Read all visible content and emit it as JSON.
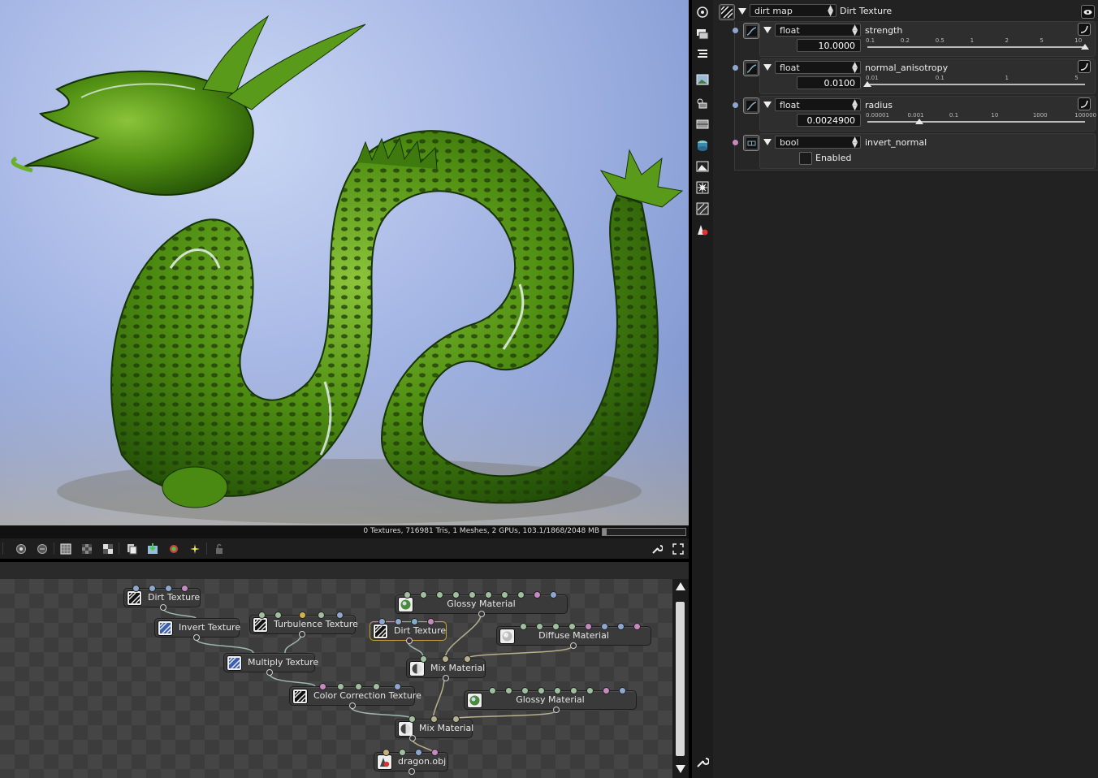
{
  "status": {
    "text": "0 Textures, 716981 Tris, 1 Meshes, 2 GPUs, 103.1/1868/2048 MB",
    "memory_used_fraction": 0.05
  },
  "nodes": [
    {
      "label": "Dirt Texture"
    },
    {
      "label": "Invert Texture"
    },
    {
      "label": "Turbulence Texture"
    },
    {
      "label": "Multiply Texture"
    },
    {
      "label": "Color Correction Texture"
    },
    {
      "label": "Glossy Material"
    },
    {
      "label": "Dirt Texture"
    },
    {
      "label": "Diffuse Material"
    },
    {
      "label": "Mix Material"
    },
    {
      "label": "Glossy Material"
    },
    {
      "label": "Mix Material"
    },
    {
      "label": "dragon.obj"
    }
  ],
  "panel": {
    "node_name": "dirt map",
    "node_type": "Dirt Texture",
    "attributes": [
      {
        "type": "float",
        "name": "strength",
        "value": "10.0000",
        "ticks": [
          "0.1",
          "0.2",
          "0.5",
          "1",
          "2",
          "5",
          "10"
        ],
        "position": 1.0
      },
      {
        "type": "float",
        "name": "normal_anisotropy",
        "value": "0.0100",
        "ticks": [
          "0.01",
          "0.1",
          "1",
          "5"
        ],
        "position": 0.0
      },
      {
        "type": "float",
        "name": "radius",
        "value": "0.0024900",
        "ticks": [
          "0.00001",
          "0.001",
          "0.1",
          "10",
          "1000",
          "100000"
        ],
        "position": 0.24
      },
      {
        "type": "bool",
        "name": "invert_normal",
        "checkbox_label": "Enabled",
        "checked": false
      }
    ]
  },
  "colors": {
    "float_pin": "#8ea7cf",
    "bool_pin": "#c78ac0",
    "selected_node_border": "#c7a23a"
  }
}
